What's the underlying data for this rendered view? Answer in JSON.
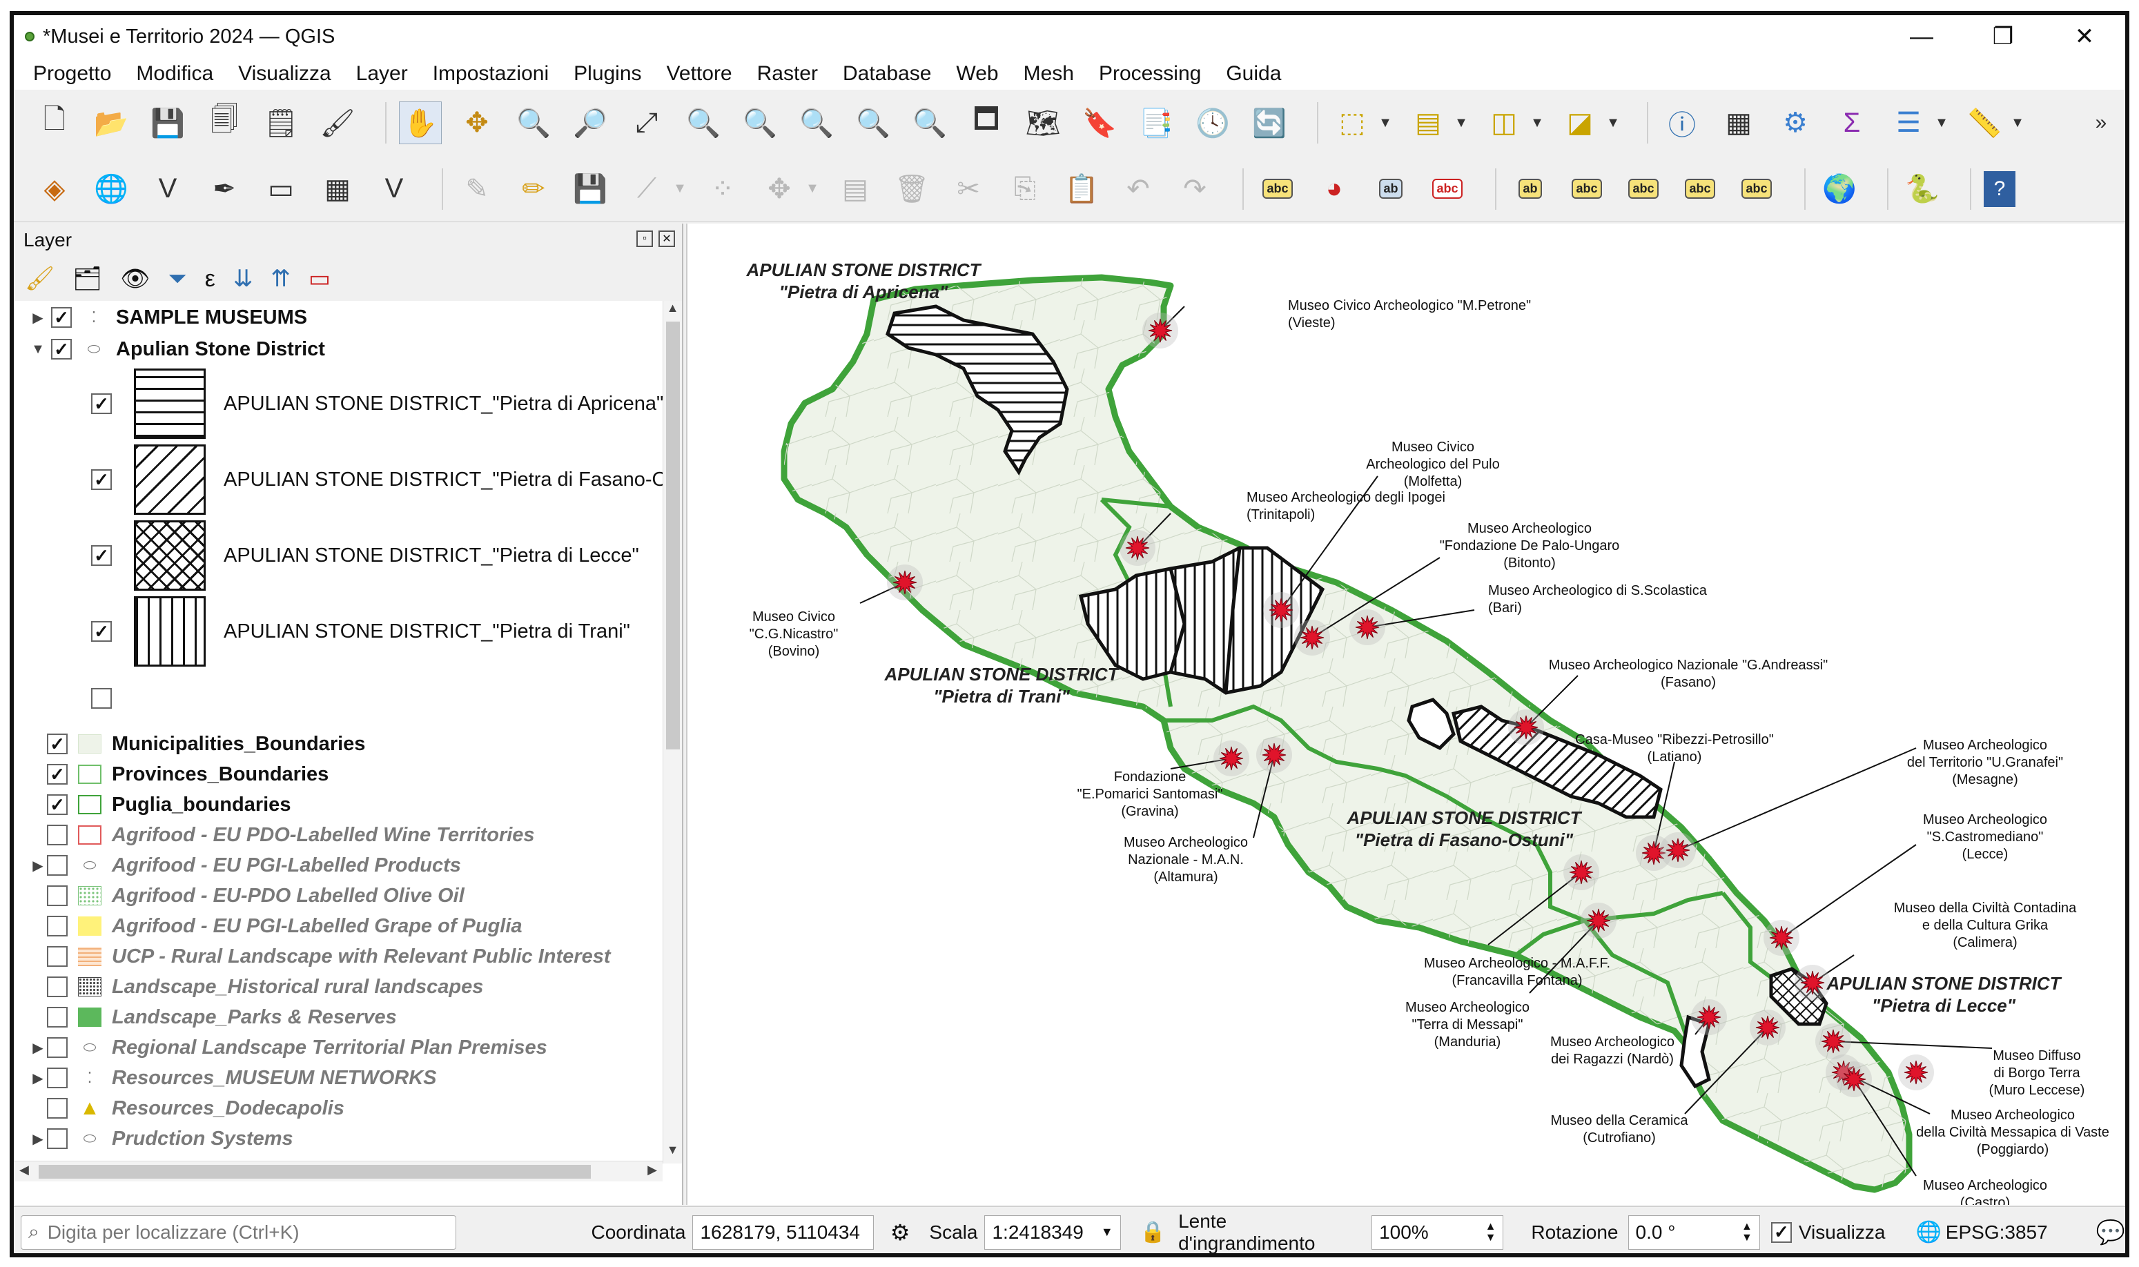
{
  "window": {
    "title": "*Musei e Territorio 2024 — QGIS",
    "minimize": "—",
    "restore": "❐",
    "close": "✕"
  },
  "menu": [
    "Progetto",
    "Modifica",
    "Visualizza",
    "Layer",
    "Impostazioni",
    "Plugins",
    "Vettore",
    "Raster",
    "Database",
    "Web",
    "Mesh",
    "Processing",
    "Guida"
  ],
  "toolbar_overflow": "»",
  "layer_panel": {
    "title": "Layer",
    "layers": [
      {
        "name": "SAMPLE MUSEUMS",
        "checked": true,
        "style": "bold",
        "icon": "point-layer-icon"
      },
      {
        "name": "Apulian Stone District",
        "checked": true,
        "style": "bold",
        "icon": "polygon-layer-icon",
        "expanded": true
      },
      {
        "name": "APULIAN STONE DISTRICT_\"Pietra di Apricena\"",
        "checked": true,
        "swatch": "horizontal-hatch"
      },
      {
        "name": "APULIAN STONE DISTRICT_\"Pietra di Fasano-Ostuni\"",
        "checked": true,
        "swatch": "diagonal-hatch"
      },
      {
        "name": "APULIAN STONE DISTRICT_\"Pietra di Lecce\"",
        "checked": true,
        "swatch": "cross-hatch"
      },
      {
        "name": "APULIAN STONE DISTRICT_\"Pietra di Trani\"",
        "checked": true,
        "swatch": "vertical-hatch"
      },
      {
        "name": "",
        "checked": false
      },
      {
        "name": "Municipalities_Boundaries",
        "checked": true,
        "style": "bold"
      },
      {
        "name": "Provinces_Boundaries",
        "checked": true,
        "style": "bold"
      },
      {
        "name": "Puglia_boundaries",
        "checked": true,
        "style": "bold"
      },
      {
        "name": "Agrifood - EU PDO-Labelled Wine Territories",
        "checked": false,
        "style": "grey"
      },
      {
        "name": "Agrifood - EU PGI-Labelled Products",
        "checked": false,
        "style": "grey"
      },
      {
        "name": "Agrifood - EU-PDO Labelled Olive Oil",
        "checked": false,
        "style": "grey"
      },
      {
        "name": "Agrifood - EU PGI-Labelled Grape of Puglia",
        "checked": false,
        "style": "grey"
      },
      {
        "name": "UCP - Rural Landscape with Relevant Public Interest",
        "checked": false,
        "style": "grey"
      },
      {
        "name": "Landscape_Historical rural landscapes",
        "checked": false,
        "style": "grey"
      },
      {
        "name": "Landscape_Parks & Reserves",
        "checked": false,
        "style": "grey"
      },
      {
        "name": "Regional Landscape Territorial Plan Premises",
        "checked": false,
        "style": "grey"
      },
      {
        "name": "Resources_MUSEUM NETWORKS",
        "checked": false,
        "style": "grey"
      },
      {
        "name": "Resources_Dodecapolis",
        "checked": false,
        "style": "grey"
      },
      {
        "name": "Prudction Systems",
        "checked": false,
        "style": "grey"
      }
    ]
  },
  "map": {
    "districts": [
      {
        "l1": "APULIAN STONE DISTRICT",
        "l2": "\"Pietra di Apricena\""
      },
      {
        "l1": "APULIAN STONE DISTRICT",
        "l2": "\"Pietra di Trani\""
      },
      {
        "l1": "APULIAN STONE DISTRICT",
        "l2": "\"Pietra di Fasano-Ostuni\""
      },
      {
        "l1": "APULIAN STONE DISTRICT",
        "l2": "\"Pietra di Lecce\""
      }
    ],
    "museums": [
      {
        "lines": [
          "Museo Civico Archeologico \"M.Petrone\"",
          "(Vieste)"
        ]
      },
      {
        "lines": [
          "Museo Civico",
          "Archeologico del Pulo",
          "(Molfetta)"
        ]
      },
      {
        "lines": [
          "Museo Archeologico degli Ipogei",
          "(Trinitapoli)"
        ]
      },
      {
        "lines": [
          "Museo Archeologico",
          "\"Fondazione De Palo-Ungaro",
          "(Bitonto)"
        ]
      },
      {
        "lines": [
          "Museo Archeologico di S.Scolastica",
          "(Bari)"
        ]
      },
      {
        "lines": [
          "Museo Civico",
          "\"C.G.Nicastro\"",
          "(Bovino)"
        ]
      },
      {
        "lines": [
          "Museo Archeologico Nazionale \"G.Andreassi\"",
          "(Fasano)"
        ]
      },
      {
        "lines": [
          "Casa-Museo \"Ribezzi-Petrosillo\"",
          "(Latiano)"
        ]
      },
      {
        "lines": [
          "Museo Archeologico",
          "del Territorio \"U.Granafei\"",
          "(Mesagne)"
        ]
      },
      {
        "lines": [
          "Fondazione",
          "\"E.Pomarici Santomasi\"",
          "(Gravina)"
        ]
      },
      {
        "lines": [
          "Museo Archeologico",
          "Nazionale - M.A.N.",
          "(Altamura)"
        ]
      },
      {
        "lines": [
          "Museo Archeologico",
          "\"S.Castromediano\"",
          "(Lecce)"
        ]
      },
      {
        "lines": [
          "Museo della Civiltà Contadina",
          "e della Cultura Grika",
          "(Calimera)"
        ]
      },
      {
        "lines": [
          "Museo Archeologico - M.A.F.F.",
          "(Francavilla Fontana)"
        ]
      },
      {
        "lines": [
          "Museo Archeologico",
          "\"Terra di Messapi\"",
          "(Manduria)"
        ]
      },
      {
        "lines": [
          "Museo Archeologico",
          "dei Ragazzi (Nardò)"
        ]
      },
      {
        "lines": [
          "Museo Diffuso",
          "di Borgo Terra",
          "(Muro Leccese)"
        ]
      },
      {
        "lines": [
          "Museo della Ceramica",
          "(Cutrofiano)"
        ]
      },
      {
        "lines": [
          "Museo Archeologico",
          "della Civiltà Messapica di Vaste",
          "(Poggiardo)"
        ]
      },
      {
        "lines": [
          "Museo Archeologico",
          "(Castro)"
        ]
      }
    ]
  },
  "status": {
    "search_placeholder": "Digita per localizzare (Ctrl+K)",
    "coord_label": "Coordinata",
    "coord_value": "1628179, 5110434",
    "scale_label": "Scala",
    "scale_value": "1:2418349",
    "magnifier_label": "Lente d'ingrandimento",
    "magnifier_value": "100%",
    "rotation_label": "Rotazione",
    "rotation_value": "0.0 °",
    "render_label": "Visualizza",
    "crs": "EPSG:3857"
  },
  "colors": {
    "region_stroke": "#3fa33a",
    "region_fill": "#eef3e9",
    "museum_marker": "#e0142b"
  }
}
